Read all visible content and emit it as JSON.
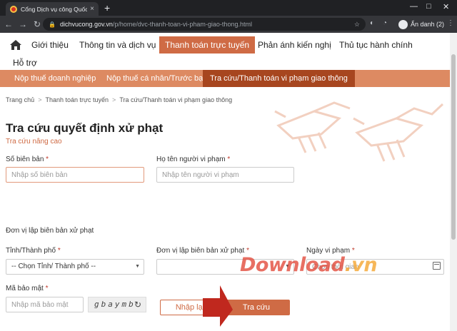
{
  "browser": {
    "tab_title": "Cổng Dịch vụ công Quốc gia",
    "tab_close": "×",
    "new_tab": "+",
    "window_controls": [
      "—",
      "□",
      "✕"
    ],
    "url_host": "dichvucong.gov.vn",
    "url_path": "/p/home/dvc-thanh-toan-vi-pham-giao-thong.html",
    "profile_label": "Ẩn danh (2)",
    "icons": [
      "back-icon",
      "forward-icon",
      "reload-icon",
      "lock-icon",
      "star-icon",
      "extension-icon",
      "history-icon",
      "profile-icon",
      "menu-icon"
    ]
  },
  "mainnav": {
    "items": [
      {
        "label": "Giới thiệu"
      },
      {
        "label": "Thông tin và dịch vụ"
      },
      {
        "label": "Thanh toán trực tuyến",
        "active": true
      },
      {
        "label": "Phản ánh kiến nghị"
      },
      {
        "label": "Thủ tục hành chính"
      },
      {
        "label": "Hỗ trợ"
      }
    ]
  },
  "subnav": {
    "items": [
      {
        "label": "Nộp thuế doanh nghiệp"
      },
      {
        "label": "Nộp thuế cá nhân/Trước bạ"
      },
      {
        "label": "Tra cứu/Thanh toán vi phạm giao thông",
        "active": true
      }
    ]
  },
  "breadcrumb": {
    "items": [
      "Trang chủ",
      "Thanh toán trực tuyến",
      "Tra cứu/Thanh toán vi phạm giao thông"
    ],
    "separator": ">"
  },
  "form": {
    "title": "Tra cứu quyết định xử phạt",
    "advanced_link": "Tra cứu nâng cao",
    "required_mark": "*",
    "record_no": {
      "label": "Số biên bản",
      "placeholder": "Nhập số biên bản",
      "value": ""
    },
    "violator": {
      "label": "Họ tên người vi phạm",
      "placeholder": "Nhập tên người vi phạm",
      "value": ""
    },
    "unit_section": "Đơn vị lập biên bản xử phạt",
    "province": {
      "label": "Tỉnh/Thành phố",
      "selected": "-- Chọn Tỉnh/ Thành phố --"
    },
    "unit": {
      "label": "Đơn vị lập biên bản xử phạt",
      "selected": ""
    },
    "date": {
      "label": "Ngày vi phạm",
      "placeholder": "Chọn thời gian"
    },
    "captcha": {
      "label": "Mã bảo mật",
      "placeholder": "Nhập mã bảo mật",
      "code": "gbaymb"
    },
    "reset_label": "Nhập lại",
    "search_label": "Tra cứu"
  },
  "watermark": {
    "text": "Download",
    "suffix": ".vn"
  },
  "colors": {
    "accent": "#cf6b45",
    "subnav": "#dd8a62",
    "subnav_active": "#a7461f",
    "required": "#c0392b"
  }
}
